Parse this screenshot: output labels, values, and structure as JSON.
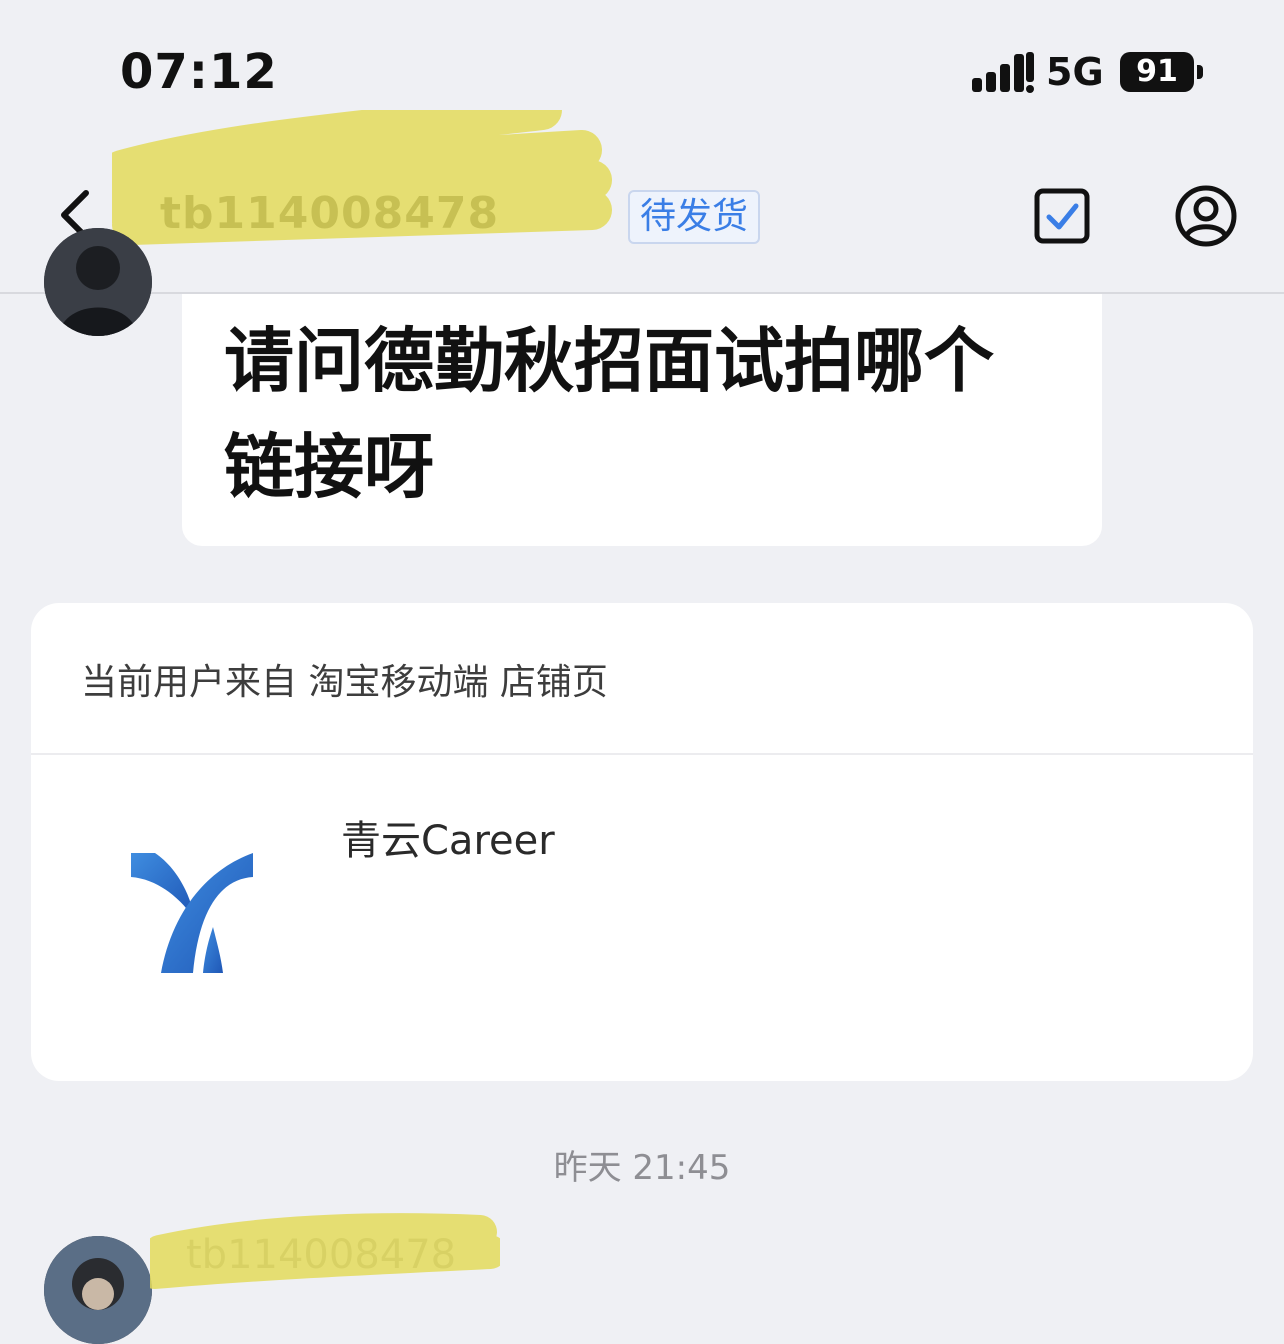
{
  "status_bar": {
    "time": "07:12",
    "network": "5G",
    "battery": "91"
  },
  "header": {
    "contact_name": "tb114008478",
    "order_status": "待发货"
  },
  "message": {
    "text": "请问德勤秋招面试拍哪个链接呀"
  },
  "source_card": {
    "source_text": "当前用户来自 淘宝移动端 店铺页",
    "shop_name": "青云Career"
  },
  "timestamp": "昨天 21:45",
  "next_message": {
    "sender": "tb114008478"
  },
  "colors": {
    "background": "#eff0f4",
    "badge_blue": "#3a7ee6",
    "logo_blue": "#2f6ad2",
    "redaction_yellow": "#e3db5a"
  },
  "icons": [
    "back-icon",
    "checkbox-checked-icon",
    "user-profile-icon",
    "shop-logo"
  ]
}
